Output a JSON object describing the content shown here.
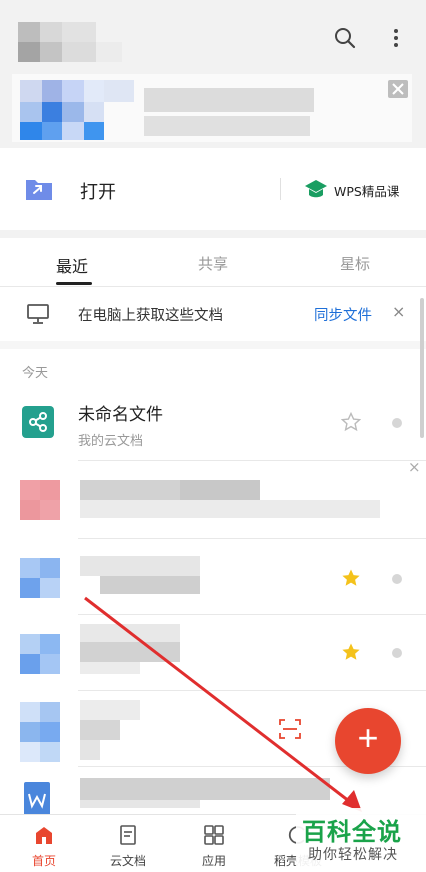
{
  "header": {
    "search_icon": "search-icon",
    "more_icon": "more-vert-icon"
  },
  "quick_actions": {
    "open_label": "打开",
    "course_label": "WPS精品课"
  },
  "tabs": [
    {
      "label": "最近"
    },
    {
      "label": "共享"
    },
    {
      "label": "星标"
    }
  ],
  "sync_banner": {
    "text": "在电脑上获取这些文档",
    "action": "同步文件",
    "close": "×"
  },
  "section": {
    "today": "今天"
  },
  "files": [
    {
      "name": "未命名文件",
      "location": "我的云文档"
    }
  ],
  "overlay": {
    "close": "×",
    "fab": "+"
  },
  "bottom_nav": [
    {
      "label": "首页"
    },
    {
      "label": "云文档"
    },
    {
      "label": "应用"
    },
    {
      "label": "稻壳模板"
    }
  ],
  "watermark": {
    "title": "百科全说",
    "subtitle": "助你轻松解决"
  },
  "colors": {
    "accent": "#e8462f",
    "blue": "#1e6fd8",
    "teal": "#24a08e",
    "star": "#f4c21b",
    "green": "#1a9e62"
  }
}
